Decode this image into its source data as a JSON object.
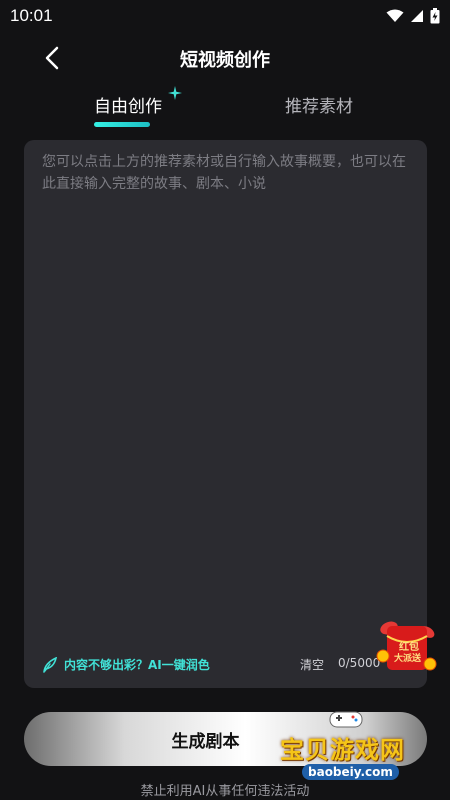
{
  "status": {
    "time": "10:01"
  },
  "nav": {
    "title": "短视频创作"
  },
  "tabs": [
    {
      "label": "自由创作",
      "active": true
    },
    {
      "label": "推荐素材",
      "active": false
    }
  ],
  "editor": {
    "placeholder": "您可以点击上方的推荐素材或自行输入故事概要，也可以在此直接输入完整的故事、剧本、小说",
    "ai_polish_label": "内容不够出彩？AI一键润色",
    "clear_label": "清空",
    "char_count": "0/5000"
  },
  "redpack": {
    "label_line1": "红包",
    "label_line2": "大派送"
  },
  "generate": {
    "label": "生成剧本"
  },
  "footer": {
    "note": "禁止利用AI从事任何违法活动"
  },
  "watermark": {
    "title": "宝贝游戏网",
    "url": "baobeiy.com"
  },
  "colors": {
    "background": "#121214",
    "editor_bg": "#2b2b30",
    "accent": "#41e1d6",
    "placeholder": "#7c7c83"
  }
}
